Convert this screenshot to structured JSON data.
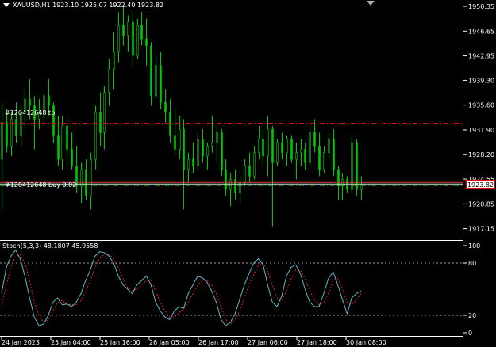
{
  "header": {
    "symbol_info": "XAUUSD,H1  1923.10 1925.07 1922.40 1923.82"
  },
  "price_axis": {
    "ticks": [
      "1950.35",
      "1946.65",
      "1942.95",
      "1939.30",
      "1935.60",
      "1931.90",
      "1928.20",
      "1924.55",
      "1920.85",
      "1917.15"
    ],
    "current_price": "1923.82"
  },
  "orders": {
    "tp_label": "#120412648 tp",
    "buy_label": "#120412648 buy 0.02",
    "tp_price": 1932.9,
    "buy_price": 1923.6
  },
  "indicator": {
    "label": "Stoch(5,3,3) 48.1807 45.9558",
    "levels": [
      "100",
      "80",
      "20",
      "0"
    ]
  },
  "time_axis": {
    "labels": [
      "24 Jan 2023",
      "25 Jan 04:00",
      "25 Jan 16:00",
      "26 Jan 05:00",
      "26 Jan 17:00",
      "27 Jan 06:00",
      "27 Jan 18:00",
      "30 Jan 08:00"
    ]
  },
  "colors": {
    "background": "#000000",
    "candle": "#00c800",
    "grid": "#ffffff",
    "tp_line": "#d01010",
    "buy_line": "#00c800",
    "stoch_main": "#5fb7c8",
    "stoch_signal": "#e02020"
  },
  "chart_data": {
    "type": "candlestick",
    "symbol": "XAUUSD",
    "timeframe": "H1",
    "ylim": [
      1915.8,
      1951.3
    ],
    "candles_ohlc": [
      [
        1927.5,
        1936.0,
        1920.0,
        1933.0
      ],
      [
        1933.0,
        1935.0,
        1928.5,
        1929.5
      ],
      [
        1929.5,
        1934.5,
        1928.0,
        1933.5
      ],
      [
        1933.5,
        1936.0,
        1930.0,
        1931.0
      ],
      [
        1931.0,
        1935.5,
        1929.5,
        1934.5
      ],
      [
        1934.5,
        1938.0,
        1932.0,
        1936.5
      ],
      [
        1936.5,
        1939.5,
        1933.5,
        1935.5
      ],
      [
        1935.5,
        1937.0,
        1929.0,
        1933.5
      ],
      [
        1933.5,
        1936.5,
        1932.0,
        1934.5
      ],
      [
        1934.5,
        1937.5,
        1932.5,
        1937.0
      ],
      [
        1937.0,
        1939.5,
        1934.0,
        1935.5
      ],
      [
        1935.5,
        1936.0,
        1930.0,
        1931.0
      ],
      [
        1931.0,
        1934.0,
        1926.5,
        1927.5
      ],
      [
        1927.5,
        1934.0,
        1926.0,
        1932.5
      ],
      [
        1932.5,
        1933.5,
        1928.0,
        1929.0
      ],
      [
        1929.0,
        1931.5,
        1926.0,
        1926.5
      ],
      [
        1926.5,
        1929.5,
        1922.5,
        1923.5
      ],
      [
        1923.5,
        1927.0,
        1921.0,
        1926.0
      ],
      [
        1926.0,
        1927.5,
        1921.5,
        1922.0
      ],
      [
        1922.0,
        1928.5,
        1920.0,
        1927.5
      ],
      [
        1927.5,
        1935.5,
        1926.0,
        1934.5
      ],
      [
        1934.5,
        1937.5,
        1929.5,
        1931.5
      ],
      [
        1931.5,
        1938.5,
        1929.0,
        1937.5
      ],
      [
        1937.5,
        1942.5,
        1935.5,
        1941.0
      ],
      [
        1941.0,
        1946.5,
        1938.0,
        1943.5
      ],
      [
        1943.5,
        1949.5,
        1942.0,
        1947.5
      ],
      [
        1947.5,
        1950.5,
        1944.5,
        1946.0
      ],
      [
        1946.0,
        1949.0,
        1943.5,
        1948.0
      ],
      [
        1948.0,
        1949.5,
        1941.5,
        1943.0
      ],
      [
        1943.0,
        1948.5,
        1942.5,
        1947.5
      ],
      [
        1947.5,
        1949.5,
        1944.5,
        1945.5
      ],
      [
        1945.5,
        1948.5,
        1941.5,
        1944.5
      ],
      [
        1944.5,
        1945.0,
        1935.5,
        1937.0
      ],
      [
        1937.0,
        1943.0,
        1936.5,
        1941.5
      ],
      [
        1941.5,
        1943.5,
        1935.0,
        1936.0
      ],
      [
        1936.0,
        1938.0,
        1933.0,
        1934.5
      ],
      [
        1934.5,
        1936.5,
        1930.0,
        1931.0
      ],
      [
        1931.0,
        1935.0,
        1928.0,
        1929.0
      ],
      [
        1929.0,
        1934.0,
        1927.5,
        1932.0
      ],
      [
        1932.0,
        1933.5,
        1920.0,
        1926.0
      ],
      [
        1926.0,
        1928.5,
        1924.0,
        1927.5
      ],
      [
        1927.5,
        1930.0,
        1925.5,
        1926.5
      ],
      [
        1926.5,
        1931.5,
        1926.0,
        1930.5
      ],
      [
        1930.5,
        1932.0,
        1927.0,
        1928.0
      ],
      [
        1928.0,
        1930.0,
        1926.0,
        1929.5
      ],
      [
        1929.5,
        1934.0,
        1928.5,
        1930.0
      ],
      [
        1930.0,
        1932.5,
        1927.0,
        1931.5
      ],
      [
        1931.5,
        1932.0,
        1925.0,
        1926.0
      ],
      [
        1926.0,
        1927.5,
        1922.0,
        1923.0
      ],
      [
        1923.0,
        1925.5,
        1920.5,
        1924.5
      ],
      [
        1924.5,
        1926.0,
        1921.5,
        1922.5
      ],
      [
        1922.5,
        1925.0,
        1921.0,
        1924.0
      ],
      [
        1924.0,
        1927.5,
        1923.5,
        1926.5
      ],
      [
        1926.5,
        1928.5,
        1924.0,
        1925.0
      ],
      [
        1925.0,
        1929.5,
        1924.5,
        1928.5
      ],
      [
        1928.5,
        1932.5,
        1927.5,
        1930.5
      ],
      [
        1930.5,
        1932.0,
        1926.5,
        1928.0
      ],
      [
        1928.0,
        1934.0,
        1925.0,
        1932.0
      ],
      [
        1932.0,
        1932.5,
        1917.5,
        1927.0
      ],
      [
        1927.0,
        1930.5,
        1926.5,
        1930.0
      ],
      [
        1930.0,
        1931.5,
        1927.5,
        1928.5
      ],
      [
        1928.5,
        1931.0,
        1926.5,
        1930.5
      ],
      [
        1930.5,
        1931.0,
        1927.0,
        1927.5
      ],
      [
        1927.5,
        1930.0,
        1924.5,
        1928.5
      ],
      [
        1928.5,
        1930.5,
        1926.5,
        1929.0
      ],
      [
        1929.0,
        1930.0,
        1926.0,
        1927.0
      ],
      [
        1927.0,
        1932.5,
        1926.5,
        1931.5
      ],
      [
        1931.5,
        1933.5,
        1928.5,
        1929.5
      ],
      [
        1929.5,
        1931.5,
        1925.0,
        1926.0
      ],
      [
        1926.0,
        1929.5,
        1925.5,
        1928.5
      ],
      [
        1928.5,
        1931.5,
        1927.5,
        1930.5
      ],
      [
        1930.5,
        1932.0,
        1925.0,
        1926.0
      ],
      [
        1926.0,
        1926.5,
        1921.5,
        1923.5
      ],
      [
        1923.5,
        1925.5,
        1921.5,
        1924.5
      ],
      [
        1924.5,
        1925.0,
        1922.5,
        1923.0
      ],
      [
        1923.0,
        1931.0,
        1922.5,
        1930.0
      ],
      [
        1930.0,
        1930.5,
        1922.0,
        1923.0
      ],
      [
        1923.0,
        1925.0,
        1921.5,
        1923.82
      ]
    ],
    "stochastic": {
      "name": "Stoch(5,3,3)",
      "main_last": 48.1807,
      "signal_last": 45.9558,
      "ylim": [
        0,
        100
      ],
      "levels": [
        80,
        20
      ],
      "main": [
        45,
        75,
        88,
        95,
        85,
        65,
        40,
        18,
        8,
        10,
        20,
        35,
        40,
        32,
        33,
        30,
        35,
        45,
        60,
        72,
        88,
        93,
        92,
        88,
        80,
        65,
        55,
        50,
        45,
        55,
        60,
        65,
        55,
        35,
        25,
        18,
        15,
        25,
        30,
        28,
        45,
        55,
        65,
        63,
        58,
        48,
        35,
        15,
        8,
        12,
        22,
        38,
        55,
        68,
        80,
        85,
        78,
        55,
        35,
        30,
        42,
        65,
        75,
        78,
        68,
        50,
        35,
        30,
        30,
        45,
        62,
        70,
        55,
        38,
        22,
        40,
        45,
        48
      ],
      "signal": [
        30,
        55,
        75,
        88,
        90,
        80,
        60,
        35,
        20,
        12,
        15,
        25,
        35,
        37,
        33,
        32,
        32,
        37,
        47,
        60,
        75,
        85,
        90,
        90,
        85,
        75,
        62,
        52,
        48,
        50,
        55,
        60,
        60,
        48,
        35,
        25,
        18,
        18,
        23,
        27,
        35,
        45,
        55,
        60,
        60,
        55,
        45,
        30,
        15,
        10,
        15,
        25,
        40,
        55,
        67,
        77,
        80,
        70,
        55,
        40,
        37,
        48,
        62,
        72,
        72,
        62,
        48,
        38,
        32,
        35,
        45,
        60,
        62,
        50,
        35,
        32,
        38,
        45
      ]
    }
  }
}
